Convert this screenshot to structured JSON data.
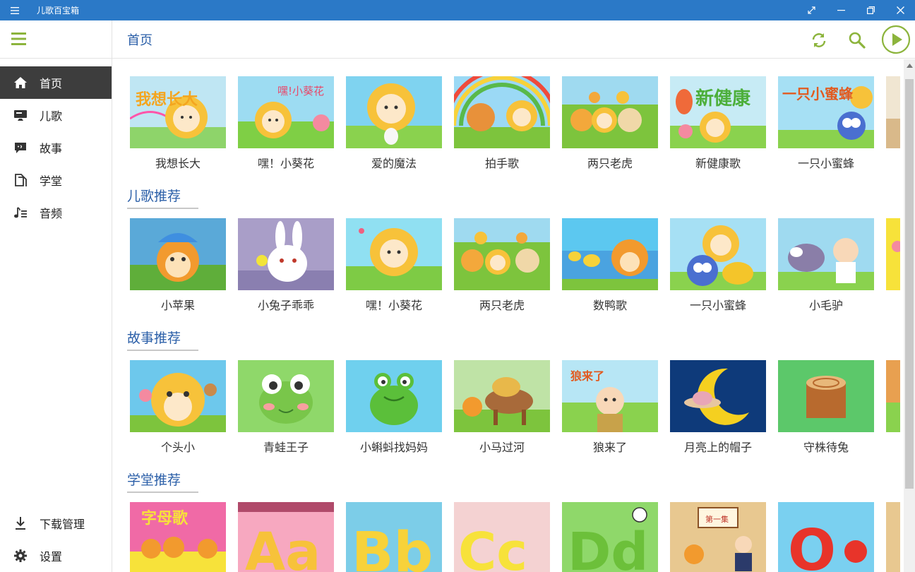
{
  "window": {
    "title": "儿歌百宝箱"
  },
  "colors": {
    "titlebar": "#2b79c7",
    "accent_green": "#8cb43c",
    "title_blue": "#2b5fa8",
    "nav_active": "#3d3d3d"
  },
  "header": {
    "title": "首页",
    "icons": [
      "refresh-icon",
      "search-icon",
      "play-icon"
    ]
  },
  "sidebar": {
    "menu_icon": "hamburger-icon",
    "items": [
      {
        "label": "首页",
        "icon": "home-icon",
        "active": true
      },
      {
        "label": "儿歌",
        "icon": "monitor-icon"
      },
      {
        "label": "故事",
        "icon": "chat-icon"
      },
      {
        "label": "学堂",
        "icon": "book-icon"
      },
      {
        "label": "音频",
        "icon": "music-list-icon"
      }
    ],
    "bottom": [
      {
        "label": "下载管理",
        "icon": "download-icon"
      },
      {
        "label": "设置",
        "icon": "gear-icon"
      }
    ]
  },
  "sections": [
    {
      "title": "",
      "items": [
        "我想长大",
        "嘿！小葵花",
        "爱的魔法",
        "拍手歌",
        "两只老虎",
        "新健康歌",
        "一只小蜜蜂"
      ]
    },
    {
      "title": "儿歌推荐",
      "items": [
        "小苹果",
        "小兔子乖乖",
        "嘿！小葵花",
        "两只老虎",
        "数鸭歌",
        "一只小蜜蜂",
        "小毛驴"
      ]
    },
    {
      "title": "故事推荐",
      "items": [
        "个头小",
        "青蛙王子",
        "小蝌蚪找妈妈",
        "小马过河",
        "狼来了",
        "月亮上的帽子",
        "守株待兔"
      ]
    },
    {
      "title": "学堂推荐",
      "items": [
        "",
        "",
        "",
        "",
        "",
        "",
        ""
      ]
    }
  ],
  "thumb_text": {
    "s0": [
      "我想长大",
      "嘿!小葵花",
      "",
      "",
      "",
      "新健康",
      "一只小蜜蜂"
    ],
    "s3": [
      "字母歌",
      "Aa",
      "Bb",
      "Cc",
      "Dd",
      "第一集",
      "O"
    ]
  }
}
